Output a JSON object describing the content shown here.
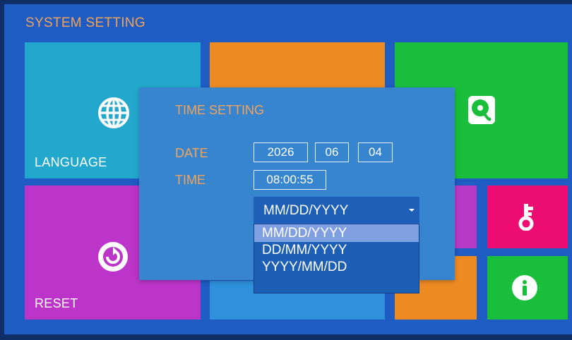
{
  "header": {
    "title": "SYSTEM SETTING"
  },
  "tiles": {
    "language": {
      "label": "LANGUAGE",
      "color": "#22a8cc"
    },
    "reset": {
      "label": "RESET",
      "color": "#bd34c9"
    },
    "orange_top": {
      "color": "#ee8a22"
    },
    "green_storage": {
      "color": "#19bf3b"
    },
    "key": {
      "color": "#ec0c72"
    },
    "info": {
      "color": "#19bf3b"
    },
    "magenta_mid": {
      "color": "#b73ac7"
    },
    "orange_bottom": {
      "color": "#ee8a22"
    },
    "blue_bottom": {
      "color": "#2f90dc"
    }
  },
  "dialog": {
    "title": "TIME SETTING",
    "date_label": "DATE",
    "time_label": "TIME",
    "year": "2026",
    "month": "06",
    "day": "04",
    "time": "08:00:55",
    "format_selected": "MM/DD/YYYY",
    "format_options": [
      "MM/DD/YYYY",
      "DD/MM/YYYY",
      "YYYY/MM/DD"
    ]
  },
  "icons": [
    "globe-icon",
    "storage-icon",
    "reset-icon",
    "key-icon",
    "info-icon",
    "dropdown-caret-icon"
  ]
}
